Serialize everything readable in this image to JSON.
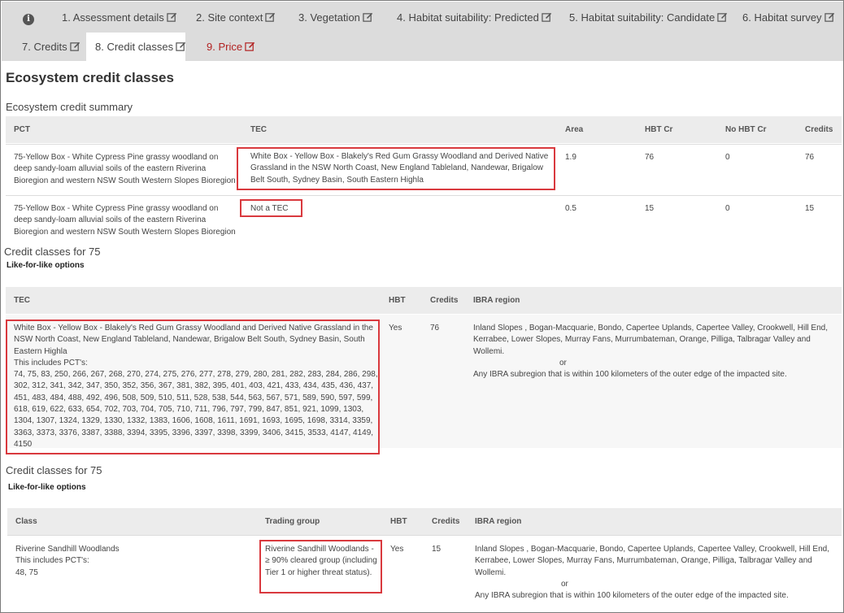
{
  "tabs": [
    {
      "label": "1. Assessment details"
    },
    {
      "label": "2. Site context"
    },
    {
      "label": "3. Vegetation"
    },
    {
      "label": "4. Habitat suitability: Predicted"
    },
    {
      "label": "5. Habitat suitability: Candidate"
    },
    {
      "label": "6. Habitat survey"
    },
    {
      "label": "7. Credits"
    },
    {
      "label": "8. Credit classes"
    },
    {
      "label": "9. Price"
    }
  ],
  "colors": {
    "tab_bg": "#dcdcdc",
    "price_tab": "#b22222",
    "highlight": "#d9393e",
    "header_bg": "#ececec"
  },
  "page_title": "Ecosystem credit classes",
  "summary": {
    "heading": "Ecosystem credit summary",
    "headers": [
      "PCT",
      "TEC",
      "Area",
      "HBT Cr",
      "No HBT Cr",
      "Credits"
    ],
    "rows": [
      {
        "pct": "75-Yellow Box - White Cypress Pine grassy woodland on deep sandy-loam alluvial soils of the eastern Riverina Bioregion and western NSW South Western Slopes Bioregion",
        "tec": "White Box - Yellow Box - Blakely's Red Gum Grassy Woodland and Derived Native Grassland in the NSW North Coast, New England Tableland, Nandewar, Brigalow Belt South, Sydney Basin, South Eastern Highla",
        "area": "1.9",
        "hbt": "76",
        "nohbt": "0",
        "credits": "76"
      },
      {
        "pct": "75-Yellow Box - White Cypress Pine grassy woodland on deep sandy-loam alluvial soils of the eastern Riverina Bioregion and western NSW South Western Slopes Bioregion",
        "tec": "Not a TEC",
        "area": "0.5",
        "hbt": "15",
        "nohbt": "0",
        "credits": "15"
      }
    ]
  },
  "cc1": {
    "heading": "Credit classes for 75",
    "subheading": "Like-for-like options",
    "headers": [
      "TEC",
      "HBT",
      "Credits",
      "IBRA region"
    ],
    "row": {
      "tec": "White Box - Yellow Box - Blakely's Red Gum Grassy Woodland and Derived Native Grassland in the NSW North Coast, New England Tableland, Nandewar, Brigalow Belt South, Sydney Basin, South Eastern Highla",
      "includes": "This includes PCT's:",
      "pcts": "74, 75, 83, 250, 266, 267, 268, 270, 274, 275, 276, 277, 278, 279, 280, 281, 282, 283, 284, 286, 298, 302, 312, 341, 342, 347, 350, 352, 356, 367, 381, 382, 395, 401, 403, 421, 433, 434, 435, 436, 437, 451, 483, 484, 488, 492, 496, 508, 509, 510, 511, 528, 538, 544, 563, 567, 571, 589, 590, 597, 599, 618, 619, 622, 633, 654, 702, 703, 704, 705, 710, 711, 796, 797, 799, 847, 851, 921, 1099, 1303, 1304, 1307, 1324, 1329, 1330, 1332, 1383, 1606, 1608, 1611, 1691, 1693, 1695, 1698, 3314, 3359, 3363, 3373, 3376, 3387, 3388, 3394, 3395, 3396, 3397, 3398, 3399, 3406, 3415, 3533, 4147, 4149, 4150",
      "hbt": "Yes",
      "credits": "76",
      "ibra": "Inland Slopes , Bogan-Macquarie, Bondo, Capertee Uplands, Capertee Valley, Crookwell, Hill End, Kerrabee, Lower Slopes, Murray Fans, Murrumbateman, Orange, Pilliga, Talbragar Valley and Wollemi.",
      "or": "or",
      "ibra2": "Any IBRA subregion that is within 100 kilometers of the outer edge of the impacted site."
    }
  },
  "cc2": {
    "heading": "Credit classes for 75",
    "subheading": "Like-for-like options",
    "headers": [
      "Class",
      "Trading group",
      "HBT",
      "Credits",
      "IBRA region"
    ],
    "row": {
      "class": "Riverine Sandhill Woodlands",
      "includes": "This includes PCT's:",
      "pcts": "48, 75",
      "trading": "Riverine Sandhill Woodlands - ≥ 90% cleared group (including Tier 1 or higher threat status).",
      "hbt": "Yes",
      "credits": "15",
      "ibra": "Inland Slopes , Bogan-Macquarie, Bondo, Capertee Uplands, Capertee Valley, Crookwell, Hill End, Kerrabee, Lower Slopes, Murray Fans, Murrumbateman, Orange, Pilliga, Talbragar Valley and Wollemi.",
      "or": "or",
      "ibra2": "Any IBRA subregion that is within 100 kilometers of the outer edge of the impacted site."
    }
  }
}
